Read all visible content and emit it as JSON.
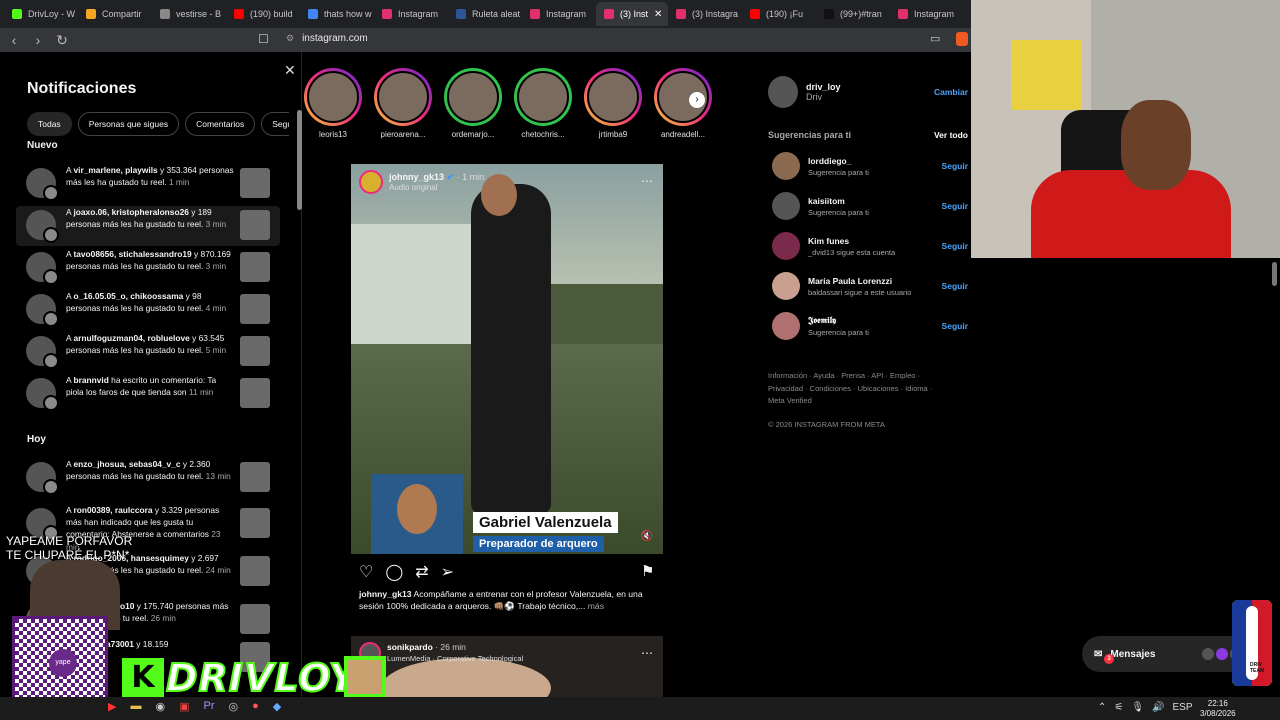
{
  "browser": {
    "tabs": [
      {
        "label": "DrivLoy - W",
        "color": "#53fc18"
      },
      {
        "label": "Compartir",
        "color": "#f5a623"
      },
      {
        "label": "vestirse - B",
        "color": "#888888"
      },
      {
        "label": "(190) build",
        "color": "#ff0000"
      },
      {
        "label": "thats how w",
        "color": "#4285f4"
      },
      {
        "label": "Instagram",
        "color": "#e1306c"
      },
      {
        "label": "Ruleta aleat",
        "color": "#2b579a"
      },
      {
        "label": "Instagram",
        "color": "#e1306c"
      },
      {
        "label": "(3) Inst",
        "color": "#e1306c"
      },
      {
        "label": "(3) Instagra",
        "color": "#e1306c"
      },
      {
        "label": "(190) ¡Fu",
        "color": "#ff0000"
      },
      {
        "label": "(99+)#tran",
        "color": "#111111"
      },
      {
        "label": "Instagram",
        "color": "#e1306c"
      }
    ],
    "url": "instagram.com"
  },
  "notifications": {
    "title": "Notificaciones",
    "filters": [
      "Todas",
      "Personas que sigues",
      "Comentarios",
      "Seguid"
    ],
    "section_new": "Nuevo",
    "section_today": "Hoy",
    "new_items": [
      {
        "users": "vir_marlene, playwils",
        "text": " y 353.364 personas más les ha gustado tu reel.",
        "time": "1 min"
      },
      {
        "users": "joaxo.06, kristopheralonso26",
        "text": " y 189 personas más les ha gustado tu reel.",
        "time": "3 min"
      },
      {
        "users": "tavo08656, stichalessandro19",
        "text": " y 870.169 personas más les ha gustado tu reel.",
        "time": "3 min"
      },
      {
        "users": "o_16.05.05_o, chikoossama",
        "text": " y 98 personas más les ha gustado tu reel.",
        "time": "4 min"
      },
      {
        "users": "arnulfoguzman04, robluelove",
        "text": " y 63.545 personas más les ha gustado tu reel.",
        "time": "5 min"
      },
      {
        "users": "brannvid",
        "text": " ha escrito un comentario: Ta piola los faros de que tienda son",
        "time": "11 min"
      }
    ],
    "today_items": [
      {
        "users": "enzo_jhosua, sebas04_v_c",
        "text": " y 2.360 personas más les ha gustado tu reel.",
        "time": "13 min"
      },
      {
        "users": "ron00389, raulccora",
        "text": " y 3.329 personas más han indicado que les gusta tu comentario: Abstenerse a comentarios",
        "time": "23 min"
      },
      {
        "users": "rodrigo_2006, hansesquimey",
        "text": " y 2.697 personas más les ha gustado tu reel.",
        "time": "24 min"
      },
      {
        "users": "007, x.gringo10",
        "text": " y 175.740 personas más les ha gustado tu reel.",
        "time": "26 min"
      },
      {
        "users": "blanquita73001",
        "text": " y 18.159",
        "time": ""
      }
    ]
  },
  "stories": [
    {
      "name": "leoris13",
      "ring": "grad"
    },
    {
      "name": "pieroarena...",
      "ring": "grad"
    },
    {
      "name": "ordemarjo...",
      "ring": "green"
    },
    {
      "name": "chetochris...",
      "ring": "green"
    },
    {
      "name": "jrtimba9",
      "ring": "grad"
    },
    {
      "name": "andreadell...",
      "ring": "grad"
    }
  ],
  "post": {
    "author": "johnny_gk13",
    "time": "1 min",
    "audio": "Audio original",
    "lower_third_name": "Gabriel Valenzuela",
    "lower_third_role": "Preparador de arquero",
    "caption_author": "johnny_gk13",
    "caption": "Acompáñame a entrenar con el profesor Valenzuela, en una sesión 100% dedicada a arqueros. 👊🏽⚽ Trabajo técnico,...",
    "more": "más"
  },
  "post2": {
    "author": "sonikpardo",
    "time": "26 min",
    "sub": "LumenMedia · Corporative Technological"
  },
  "sidebar": {
    "username": "driv_loy",
    "name": "Driv",
    "switch": "Cambiar",
    "suggestions_title": "Sugerencias para ti",
    "see_all": "Ver todo",
    "follow": "Seguir",
    "suggestions": [
      {
        "name": "lorddiego_",
        "sub": "Sugerencia para ti"
      },
      {
        "name": "kaisiitom",
        "sub": "Sugerencia para ti"
      },
      {
        "name": "Kim funes",
        "sub": "_dvid13 sigue esta cuenta"
      },
      {
        "name": "María Paula Lorenzzi",
        "sub": "baldassari sigue a este usuario"
      },
      {
        "name": "𝕵𝖔𝖊𝖒𝖎𝖑𝖞",
        "sub": "Sugerencia para ti"
      }
    ],
    "footer": "Información · Ayuda · Prensa · API · Empleo · Privacidad · Condiciones · Ubicaciones · Idioma · Meta Verified",
    "copyright": "© 2026 INSTAGRAM FROM META"
  },
  "messages": {
    "label": "Mensajes",
    "badge": "3"
  },
  "overlay": {
    "line1": "YAPEAME PORFAVOR",
    "line2": "TE CHUPARÉ  EL P*N*",
    "brand": "DRIVLOY",
    "kick": "K",
    "yape": "yape",
    "nba": "DRIV TEAM"
  },
  "taskbar": {
    "lang": "ESP",
    "time": "22:16",
    "date": "3/08/2026"
  }
}
